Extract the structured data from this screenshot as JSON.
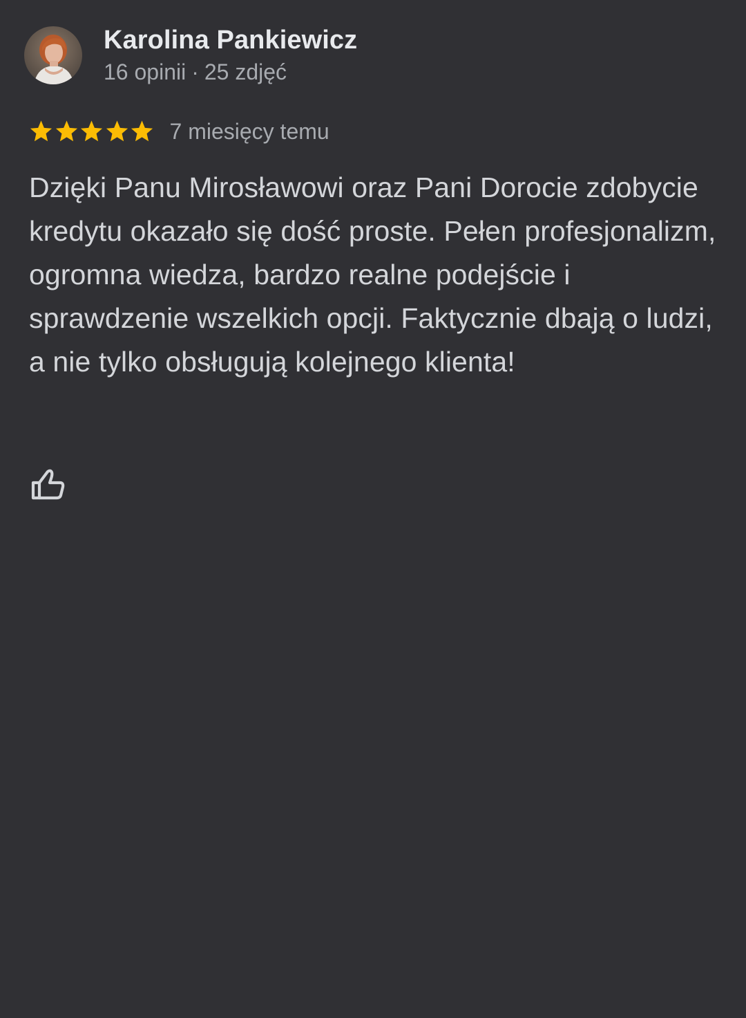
{
  "review": {
    "author": {
      "name": "Karolina Pankiewicz",
      "reviews_count": "16 opinii",
      "separator": "·",
      "photos_count": "25 zdjęć",
      "avatar_icon": "user-avatar-photo"
    },
    "rating": {
      "stars": 5,
      "max_stars": 5,
      "star_color": "#fbbc04"
    },
    "time": "7 miesięcy temu",
    "text": "Dzięki Panu Mirosławowi oraz Pani Dorocie zdobycie kredytu okazało się dość proste. Pełen profesjonalizm, ogromna wiedza, bardzo realne podejście i sprawdzenie wszelkich opcji. Faktycznie dbają o ludzi, a nie tylko obsługują kolejnego klienta!",
    "like_icon": "thumb-up-icon"
  },
  "colors": {
    "background": "#303034",
    "name_text": "#e8eaed",
    "secondary_text": "#a8abb0",
    "body_text": "#d4d6da"
  }
}
